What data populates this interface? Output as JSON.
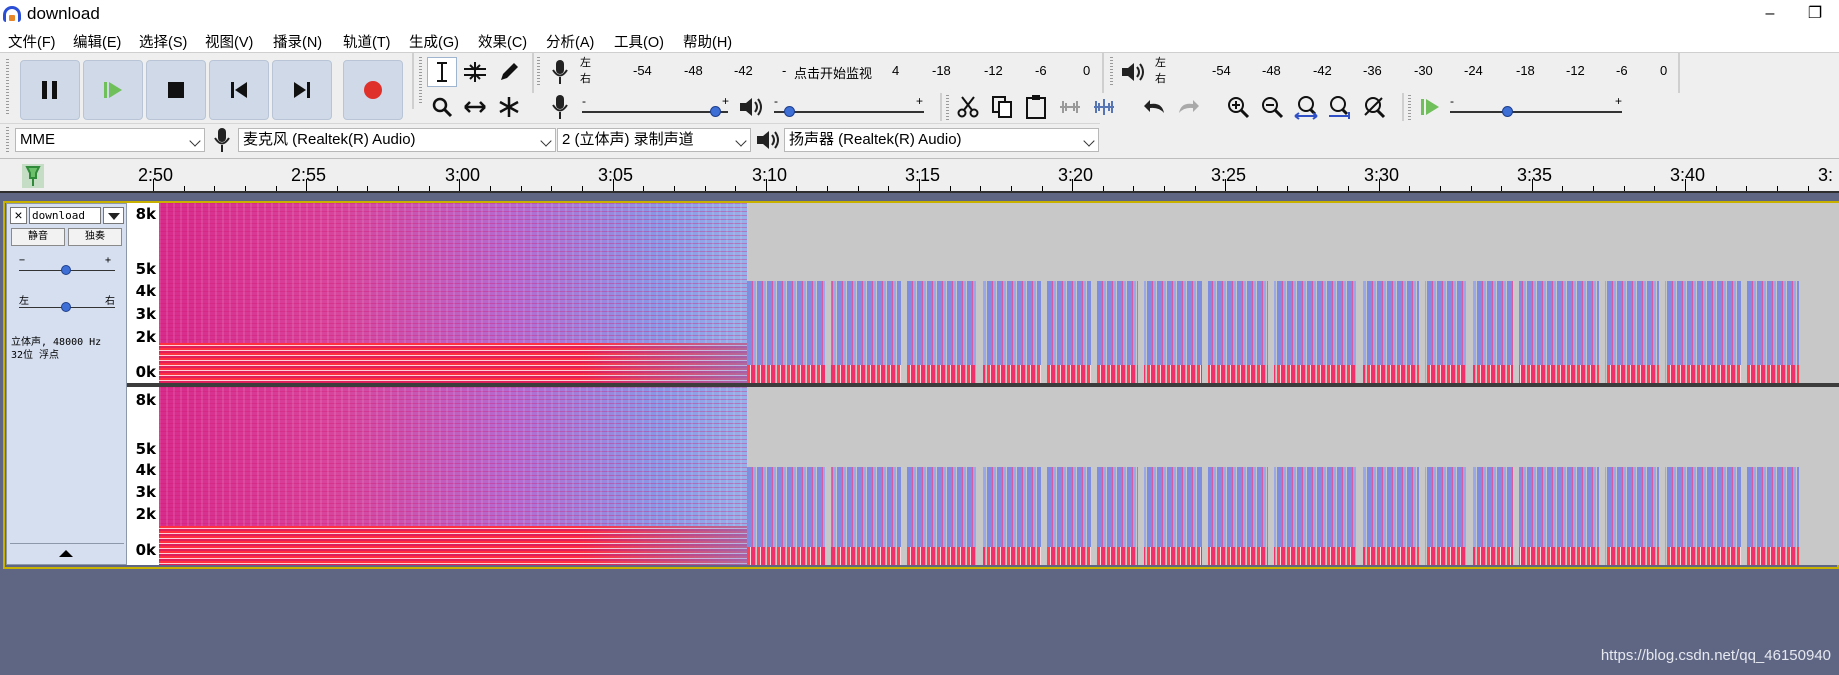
{
  "window": {
    "title": "download",
    "minimize": "–",
    "restore": "❐"
  },
  "menu": [
    "文件(F)",
    "编辑(E)",
    "选择(S)",
    "视图(V)",
    "播录(N)",
    "轨道(T)",
    "生成(G)",
    "效果(C)",
    "分析(A)",
    "工具(O)",
    "帮助(H)"
  ],
  "transport": [
    "pause",
    "play",
    "stop",
    "skip-to-start",
    "skip-to-end",
    "record"
  ],
  "record_meter": {
    "left": "左",
    "right": "右",
    "ticks": [
      "-54",
      "-48",
      "-42",
      "-",
      "-1",
      "4",
      "-18",
      "-12",
      "-6",
      "0"
    ],
    "prompt": "点击开始监视"
  },
  "play_meter": {
    "left": "左",
    "right": "右",
    "ticks": [
      "-54",
      "-48",
      "-42",
      "-36",
      "-30",
      "-24",
      "-18",
      "-12",
      "-6",
      "0"
    ]
  },
  "mixer": {
    "minus": "-",
    "plus": "+",
    "record_volume": 0.92,
    "play_volume": 0.08,
    "play_speed": 0.34
  },
  "devices": {
    "host": "MME",
    "input": "麦克风 (Realtek(R) Audio)",
    "channels": "2 (立体声) 录制声道",
    "output": "扬声器 (Realtek(R) Audio)"
  },
  "ruler": [
    "2:50",
    "2:55",
    "3:00",
    "3:05",
    "3:10",
    "3:15",
    "3:20",
    "3:25",
    "3:30",
    "3:35",
    "3:40",
    "3:"
  ],
  "track": {
    "name": "download",
    "close": "×",
    "mute": "静音",
    "solo": "独奏",
    "gain_minus": "−",
    "gain_plus": "+",
    "pan_left": "左",
    "pan_right": "右",
    "gain": 0.5,
    "pan": 0.5,
    "info_line1": "立体声, 48000 Hz",
    "info_line2": "32位 浮点"
  },
  "freq_scale": [
    "8k",
    "5k",
    "4k",
    "3k",
    "2k",
    "0k"
  ],
  "watermark": "https://blog.csdn.net/qq_46150940",
  "colors": {
    "selection_outline": "#c9b100",
    "spectrogram_hot": "#d82b8c",
    "spectrogram_cool": "#8a98e6",
    "empty": "#c8c8c8"
  }
}
